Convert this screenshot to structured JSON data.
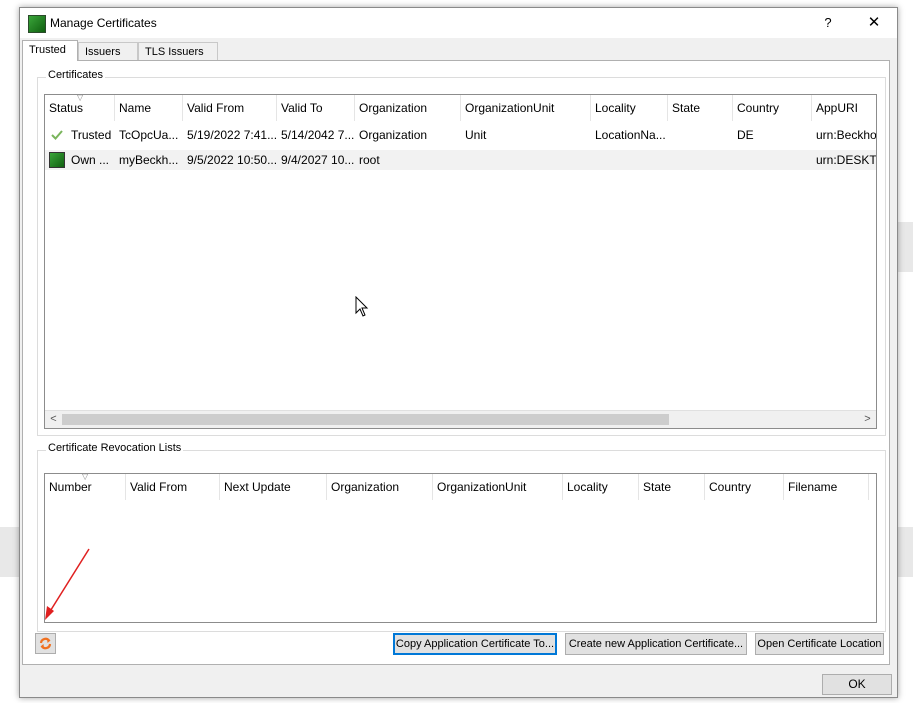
{
  "window": {
    "title": "Manage Certificates",
    "help": "?",
    "close": "✕"
  },
  "tabs": [
    "Trusted",
    "Issuers",
    "TLS Issuers"
  ],
  "certificates": {
    "label": "Certificates",
    "columns": [
      "Status",
      "Name",
      "Valid From",
      "Valid To",
      "Organization",
      "OrganizationUnit",
      "Locality",
      "State",
      "Country",
      "AppURI"
    ],
    "rows": [
      {
        "icon": "check-icon",
        "status": "Trusted",
        "name": "TcOpcUa...",
        "valid_from": "5/19/2022 7:41...",
        "valid_to": "5/14/2042 7...",
        "organization": "Organization",
        "org_unit": "Unit",
        "locality": "LocationNa...",
        "state": "",
        "country": "DE",
        "app_uri": "urn:Beckho"
      },
      {
        "icon": "own-certificate-icon",
        "status": "Own ...",
        "name": "myBeckh...",
        "valid_from": "9/5/2022 10:50...",
        "valid_to": "9/4/2027 10...",
        "organization": "root",
        "org_unit": "",
        "locality": "",
        "state": "",
        "country": "",
        "app_uri": "urn:DESKT..."
      }
    ]
  },
  "revocation": {
    "label": "Certificate Revocation Lists",
    "columns": [
      "Number",
      "Valid From",
      "Next Update",
      "Organization",
      "OrganizationUnit",
      "Locality",
      "State",
      "Country",
      "Filename"
    ]
  },
  "buttons": {
    "copy": "Copy Application Certificate To...",
    "create": "Create new Application Certificate...",
    "open": "Open Certificate Location",
    "ok": "OK",
    "refresh_icon": "refresh-icon"
  },
  "colors": {
    "accent": "#0078d7",
    "annotation_arrow": "#e02020",
    "refresh": "#f07020"
  }
}
